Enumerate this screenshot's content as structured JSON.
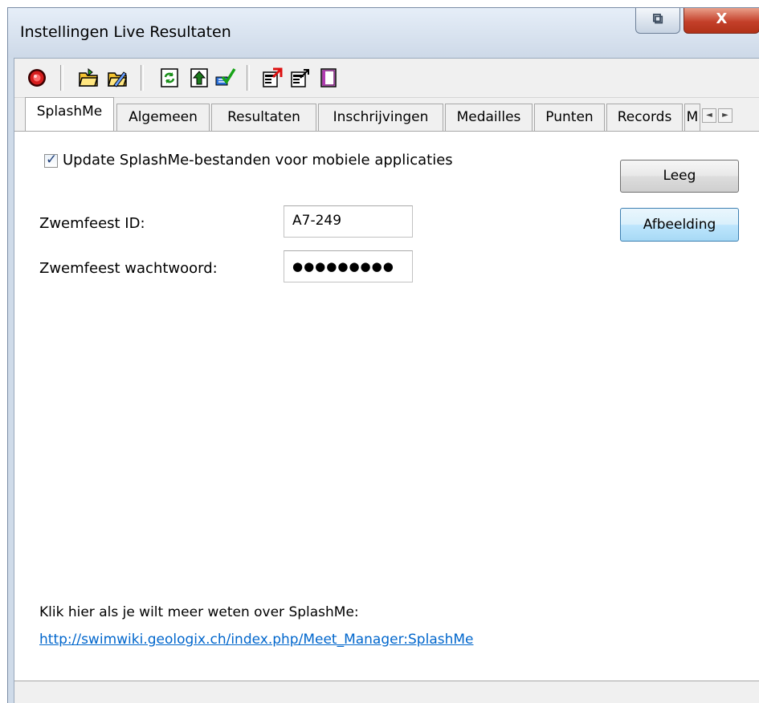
{
  "window": {
    "title": "Instellingen Live Resultaten",
    "restore_glyph": "⧉",
    "close_glyph": "X"
  },
  "toolbar": {
    "icons": [
      "record-icon",
      "open-folder-icon",
      "edit-folder-icon",
      "refresh-icon",
      "upload-icon",
      "transfer-check-icon",
      "import-settings-icon",
      "export-settings-icon",
      "document-icon"
    ]
  },
  "tabs": [
    {
      "label": "SplashMe",
      "active": true
    },
    {
      "label": "Algemeen"
    },
    {
      "label": "Resultaten"
    },
    {
      "label": "Inschrijvingen"
    },
    {
      "label": "Medailles"
    },
    {
      "label": "Punten"
    },
    {
      "label": "Records"
    },
    {
      "label": "M"
    }
  ],
  "tab_scroll": {
    "left": "◄",
    "right": "►"
  },
  "splashme": {
    "update_checkbox": {
      "checked": true,
      "label": "Update SplashMe-bestanden voor mobiele applicaties"
    },
    "id_label": "Zwemfeest ID:",
    "id_value": "A7-249",
    "password_label": "Zwemfeest wachtwoord:",
    "password_value": "●●●●●●●●●",
    "leeg_button": "Leeg",
    "afbeelding_button": "Afbeelding",
    "info_text": "Klik hier als je wilt meer weten over SplashMe:",
    "link": "http://swimwiki.geologix.ch/index.php/Meet_Manager:SplashMe"
  },
  "colors": {
    "link": "#0066cc",
    "accent": "#3c7fb1"
  }
}
